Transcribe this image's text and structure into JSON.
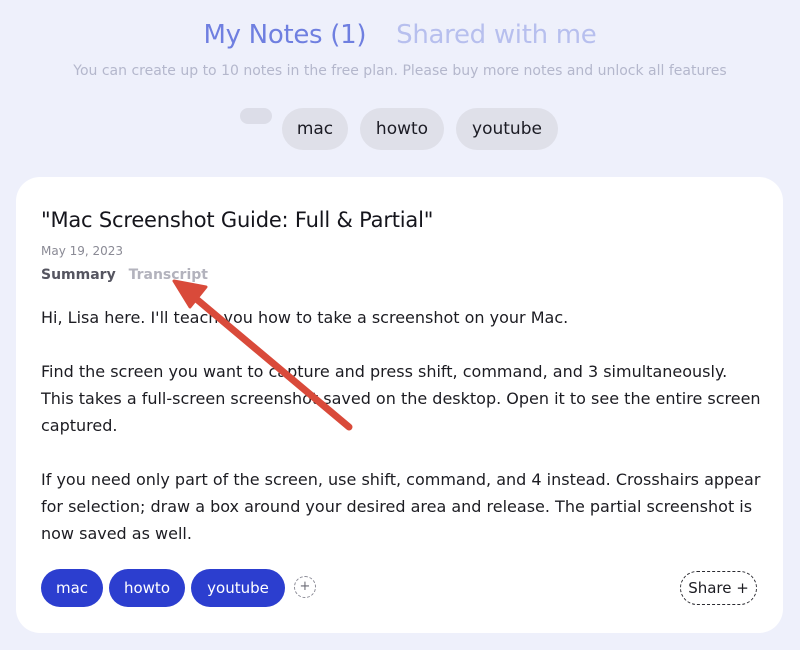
{
  "header": {
    "tabs": [
      {
        "label": "My Notes (1)",
        "active": true
      },
      {
        "label": "Shared with me",
        "active": false
      }
    ],
    "plan_notice": "You can create up to 10 notes in the free plan. Please buy more notes and unlock all features"
  },
  "filters": {
    "chips": [
      "mac",
      "howto",
      "youtube"
    ]
  },
  "note": {
    "title": "\"Mac Screenshot Guide: Full & Partial\"",
    "date": "May 19, 2023",
    "view_tabs": [
      {
        "label": "Summary",
        "active": true
      },
      {
        "label": "Transcript",
        "active": false
      }
    ],
    "paragraphs": [
      "Hi, Lisa here. I'll teach you how to take a screenshot on your Mac.",
      "Find the screen you want to capture and press shift, command, and 3 simultaneously. This takes a full-screen screenshot saved on the desktop. Open it to see the entire screen captured.",
      "If you need only part of the screen, use shift, command, and 4 instead. Crosshairs appear for selection; draw a box around your desired area and release. The partial screenshot is now saved as well."
    ],
    "tags": [
      "mac",
      "howto",
      "youtube"
    ],
    "add_tag_symbol": "+",
    "share_label": "Share +"
  },
  "colors": {
    "background": "#eef0fb",
    "tab_active": "#6f7fe0",
    "tab_inactive": "#b7bfee",
    "tag_fill": "#2c3ecf",
    "annotation_arrow": "#d94a3a"
  }
}
